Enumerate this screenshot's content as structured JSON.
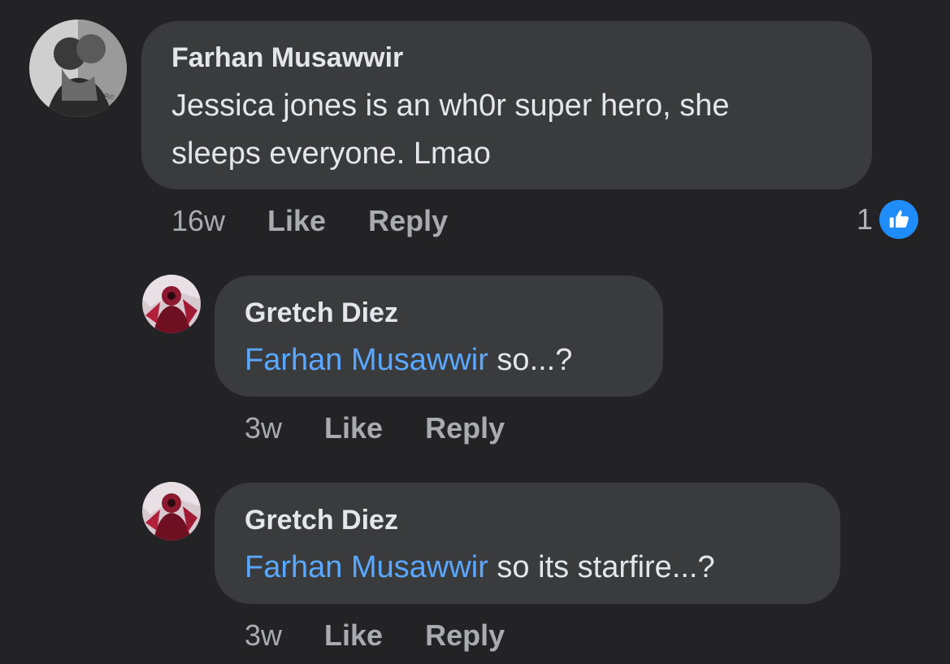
{
  "comments": [
    {
      "author": "Farhan Musawwir",
      "text_line1": "Jessica jones is an wh0r super hero, she",
      "text_line2": "sleeps everyone. Lmao",
      "time": "16w",
      "like_label": "Like",
      "reply_label": "Reply",
      "reaction_count": "1",
      "reaction_icon": "thumbs-up-icon",
      "reaction_color": "#1f8cf7"
    }
  ],
  "replies": [
    {
      "author": "Gretch Diez",
      "mention": "Farhan Musawwir",
      "text": " so...?",
      "time": "3w",
      "like_label": "Like",
      "reply_label": "Reply"
    },
    {
      "author": "Gretch Diez",
      "mention": "Farhan Musawwir",
      "text": " so its starfire...?",
      "time": "3w",
      "like_label": "Like",
      "reply_label": "Reply"
    }
  ],
  "colors": {
    "background": "#232326",
    "bubble": "#3a3b3c",
    "mention": "#5aa7ff",
    "meta_text": "#a8abaf"
  }
}
